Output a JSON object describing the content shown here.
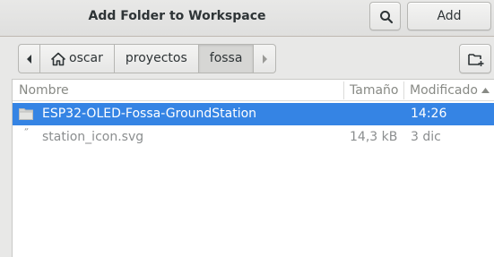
{
  "dialog": {
    "title": "Add Folder to Workspace",
    "add_label": "Add"
  },
  "pathbar": {
    "segments": [
      "oscar",
      "proyectos",
      "fossa"
    ],
    "active_index": 2
  },
  "columns": {
    "name": "Nombre",
    "size": "Tamaño",
    "modified": "Modificado"
  },
  "files": [
    {
      "icon": "folder-icon",
      "name": "ESP32-OLED-Fossa-GroundStation",
      "size": "",
      "modified": "14:26",
      "selected": true
    },
    {
      "icon": "file-icon",
      "name": "station_icon.svg",
      "size": "14,3 kB",
      "modified": "3 dic",
      "selected": false
    }
  ],
  "colors": {
    "selection": "#3584e4",
    "background": "#e8e8e7"
  }
}
